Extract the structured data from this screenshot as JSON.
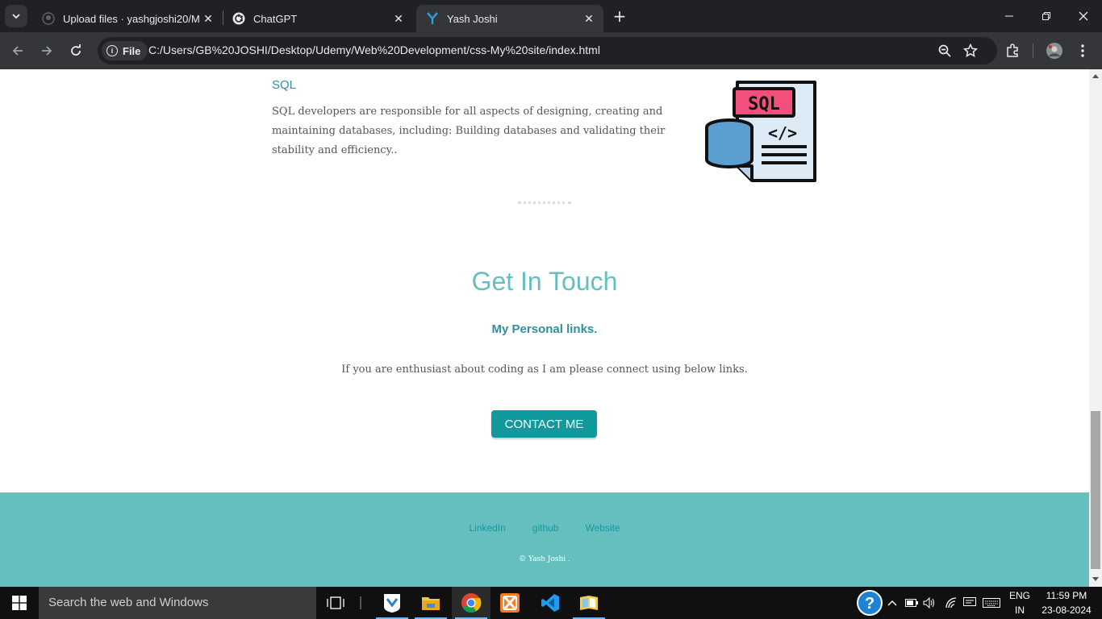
{
  "browser": {
    "tabs": [
      {
        "title": "Upload files · yashgjoshi20/My-",
        "icon": "github-icon"
      },
      {
        "title": "ChatGPT",
        "icon": "openai-icon"
      },
      {
        "title": "Yash Joshi",
        "icon": "y-logo-icon",
        "active": true
      }
    ],
    "address": {
      "chip": "File",
      "url": "C:/Users/GB%20JOSHI/Desktop/Udemy/Web%20Development/css-My%20site/index.html"
    }
  },
  "page": {
    "skill": {
      "title": "SQL",
      "description": "SQL developers are responsible for all aspects of designing, creating and maintaining databases, including: Building databases and validating their stability and efficiency..",
      "image_label": "SQL",
      "image_code": "</>"
    },
    "contact": {
      "title": "Get In Touch",
      "subtitle": "My Personal links.",
      "text": "If you are enthusiast about coding as I am please connect using below links.",
      "button": "CONTACT ME"
    },
    "footer": {
      "links": [
        "LinkedIn",
        "github",
        "Website"
      ],
      "copyright": "© Yash Joshi ."
    },
    "colors": {
      "accent": "#66bfbf",
      "primary": "#11999e",
      "dark_teal": "#2f8f9d"
    }
  },
  "taskbar": {
    "search_placeholder": "Search the web and Windows",
    "language": [
      "ENG",
      "IN"
    ],
    "time": "11:59 PM",
    "date": "23-08-2024"
  }
}
